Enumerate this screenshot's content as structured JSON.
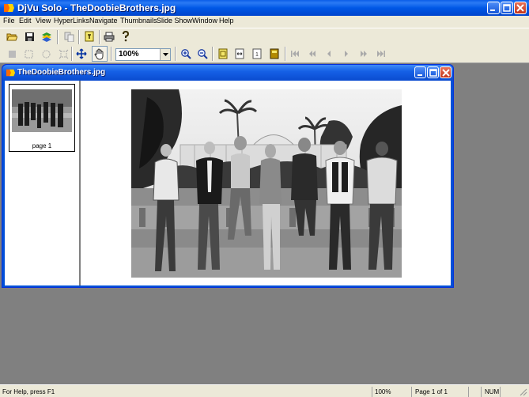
{
  "app": {
    "title": "DjVu Solo - TheDoobieBrothers.jpg"
  },
  "menu": [
    "File",
    "Edit",
    "View",
    "HyperLinks",
    "Navigate",
    "Thumbnails",
    "Slide Show",
    "Window",
    "Help"
  ],
  "toolbar": {
    "zoom_value": "100%"
  },
  "document": {
    "window_title": "TheDoobieBrothers.jpg",
    "thumbnails": [
      {
        "label": "page 1"
      }
    ]
  },
  "statusbar": {
    "help": "For Help, press F1",
    "zoom": "100%",
    "page": "Page 1 of 1",
    "num": "NUM"
  },
  "colors": {
    "titlebar": "#0058e6",
    "chrome": "#ece9d8",
    "workspace": "#808080"
  }
}
